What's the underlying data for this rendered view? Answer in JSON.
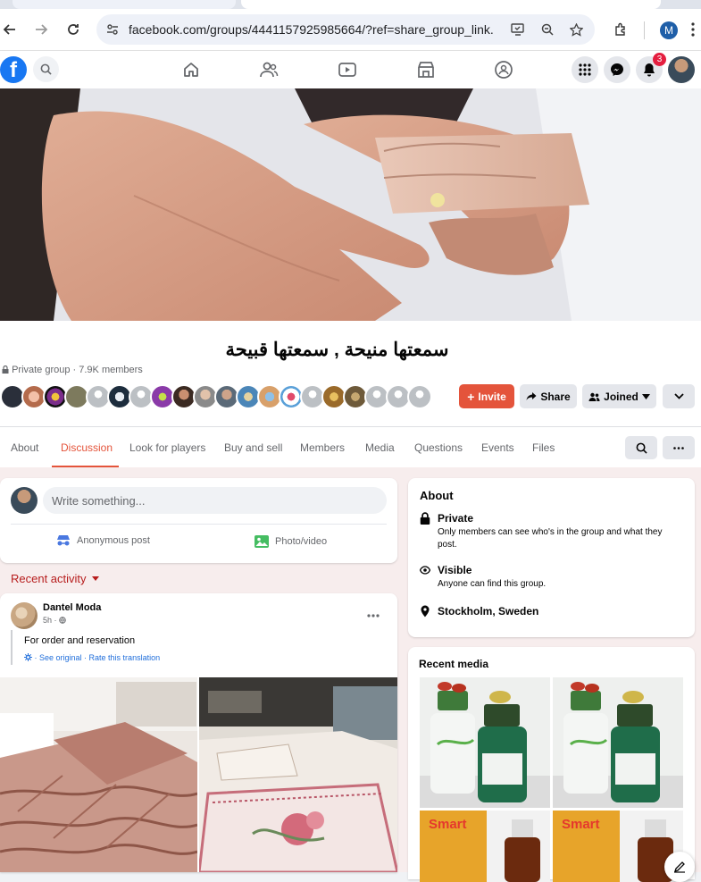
{
  "browser": {
    "url": "facebook.com/groups/4441157925985664/?ref=share_group_link...",
    "profile_initial": "M"
  },
  "fb": {
    "logo": "f",
    "notification_count": "3",
    "nav_icons": [
      "home-icon",
      "friends-icon",
      "video-icon",
      "marketplace-icon",
      "groups-icon"
    ]
  },
  "group": {
    "name": "سمعتها منيحة , سمعتها قبيحة",
    "privacy_line": "Private group · 7.9K members",
    "buttons": {
      "invite": "Invite",
      "share": "Share",
      "joined": "Joined"
    },
    "tabs": [
      "About",
      "Discussion",
      "Look for players",
      "Buy and sell",
      "Members",
      "Media",
      "Questions",
      "Events",
      "Files"
    ],
    "active_tab": "Discussion"
  },
  "composer": {
    "placeholder": "Write something...",
    "anonymous": "Anonymous post",
    "photo": "Photo/video"
  },
  "feed": {
    "sort_label": "Recent activity",
    "post": {
      "author": "Dantel Moda",
      "time": "5h · ",
      "text": "For order and reservation",
      "translation": "· See original · Rate this translation"
    }
  },
  "about": {
    "title": "About",
    "items": [
      {
        "icon": "lock-icon",
        "heading": "Private",
        "desc": "Only members can see who's in the group and what they post."
      },
      {
        "icon": "eye-icon",
        "heading": "Visible",
        "desc": "Anyone can find this group."
      },
      {
        "icon": "location-pin-icon",
        "heading": "Stockholm, Sweden",
        "desc": ""
      }
    ]
  },
  "media": {
    "title": "Recent media"
  },
  "colors": {
    "facebook_blue": "#1877f2",
    "invite_red": "#e4543b",
    "active_tab": "#e4543b"
  }
}
